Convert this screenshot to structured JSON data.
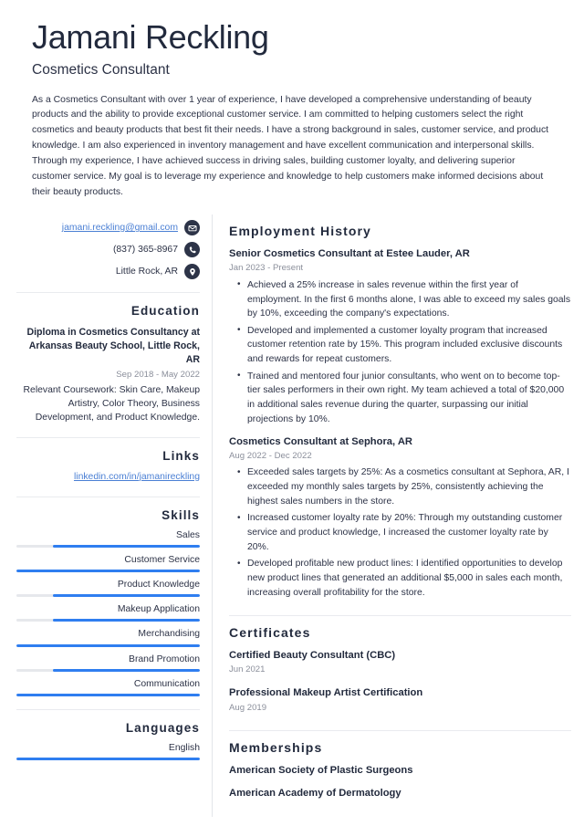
{
  "colors": {
    "accent_blue": "#2f7ef0",
    "link_blue": "#4a7fd4",
    "heading_navy": "#222a3d",
    "body_text": "#2c3246",
    "muted_date": "#8b8f9b",
    "bar_track": "#e6e8ec",
    "icon_badge": "#2d3448",
    "rule": "#e9ebef"
  },
  "header": {
    "full_name": "Jamani Reckling",
    "job_title": "Cosmetics Consultant",
    "summary": "As a Cosmetics Consultant with over 1 year of experience, I have developed a comprehensive understanding of beauty products and the ability to provide exceptional customer service. I am committed to helping customers select the right cosmetics and beauty products that best fit their needs. I have a strong background in sales, customer service, and product knowledge. I am also experienced in inventory management and have excellent communication and interpersonal skills. Through my experience, I have achieved success in driving sales, building customer loyalty, and delivering superior customer service. My goal is to leverage my experience and knowledge to help customers make informed decisions about their beauty products."
  },
  "contact": [
    {
      "icon": "envelope-icon",
      "text": "jamani.reckling@gmail.com",
      "is_link": true
    },
    {
      "icon": "phone-icon",
      "text": "(837) 365-8967",
      "is_link": false
    },
    {
      "icon": "location-pin-icon",
      "text": "Little Rock, AR",
      "is_link": false
    }
  ],
  "education": {
    "heading": "Education",
    "entries": [
      {
        "degree": "Diploma in Cosmetics Consultancy at Arkansas Beauty School, Little Rock, AR",
        "date": "Sep 2018 - May 2022",
        "description": "Relevant Coursework: Skin Care, Makeup Artistry, Color Theory, Business Development, and Product Knowledge."
      }
    ]
  },
  "links": {
    "heading": "Links",
    "items": [
      {
        "label": "linkedin.com/in/jamanireckling"
      }
    ]
  },
  "skills": {
    "heading": "Skills",
    "items": [
      {
        "label": "Sales",
        "level": 80
      },
      {
        "label": "Customer Service",
        "level": 100
      },
      {
        "label": "Product Knowledge",
        "level": 80
      },
      {
        "label": "Makeup Application",
        "level": 80
      },
      {
        "label": "Merchandising",
        "level": 100
      },
      {
        "label": "Brand Promotion",
        "level": 80
      },
      {
        "label": "Communication",
        "level": 100
      }
    ]
  },
  "languages": {
    "heading": "Languages",
    "items": [
      {
        "label": "English",
        "level": 100
      }
    ]
  },
  "employment": {
    "heading": "Employment History",
    "entries": [
      {
        "title": "Senior Cosmetics Consultant at Estee Lauder, AR",
        "date": "Jan 2023 - Present",
        "bullets": [
          "Achieved a 25% increase in sales revenue within the first year of employment. In the first 6 months alone, I was able to exceed my sales goals by 10%, exceeding the company's expectations.",
          "Developed and implemented a customer loyalty program that increased customer retention rate by 15%. This program included exclusive discounts and rewards for repeat customers.",
          "Trained and mentored four junior consultants, who went on to become top-tier sales performers in their own right. My team achieved a total of $20,000 in additional sales revenue during the quarter, surpassing our initial projections by 10%."
        ]
      },
      {
        "title": "Cosmetics Consultant at Sephora, AR",
        "date": "Aug 2022 - Dec 2022",
        "bullets": [
          "Exceeded sales targets by 25%: As a cosmetics consultant at Sephora, AR, I exceeded my monthly sales targets by 25%, consistently achieving the highest sales numbers in the store.",
          "Increased customer loyalty rate by 20%: Through my outstanding customer service and product knowledge, I increased the customer loyalty rate by 20%.",
          "Developed profitable new product lines: I identified opportunities to develop new product lines that generated an additional $5,000 in sales each month, increasing overall profitability for the store."
        ]
      }
    ]
  },
  "certificates": {
    "heading": "Certificates",
    "entries": [
      {
        "title": "Certified Beauty Consultant (CBC)",
        "date": "Jun 2021"
      },
      {
        "title": "Professional Makeup Artist Certification",
        "date": "Aug 2019"
      }
    ]
  },
  "memberships": {
    "heading": "Memberships",
    "items": [
      {
        "label": "American Society of Plastic Surgeons"
      },
      {
        "label": "American Academy of Dermatology"
      }
    ]
  }
}
